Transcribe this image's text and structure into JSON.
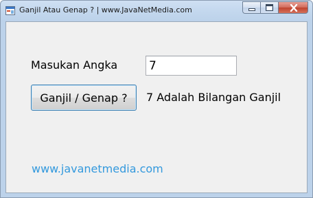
{
  "window": {
    "title": "Ganjil Atau Genap ? | www.JavaNetMedia.com",
    "accent_close": "#c0432e"
  },
  "form": {
    "input_label": "Masukan Angka",
    "input_value": "7",
    "check_button_label": "Ganjil / Genap ?",
    "result_text": "7 Adalah Bilangan Ganjil",
    "footer_link": "www.javanetmedia.com",
    "link_color": "#3399dd"
  },
  "icons": {
    "app": "app-form-icon",
    "minimize": "minimize-icon",
    "maximize": "maximize-icon",
    "close": "close-icon"
  }
}
